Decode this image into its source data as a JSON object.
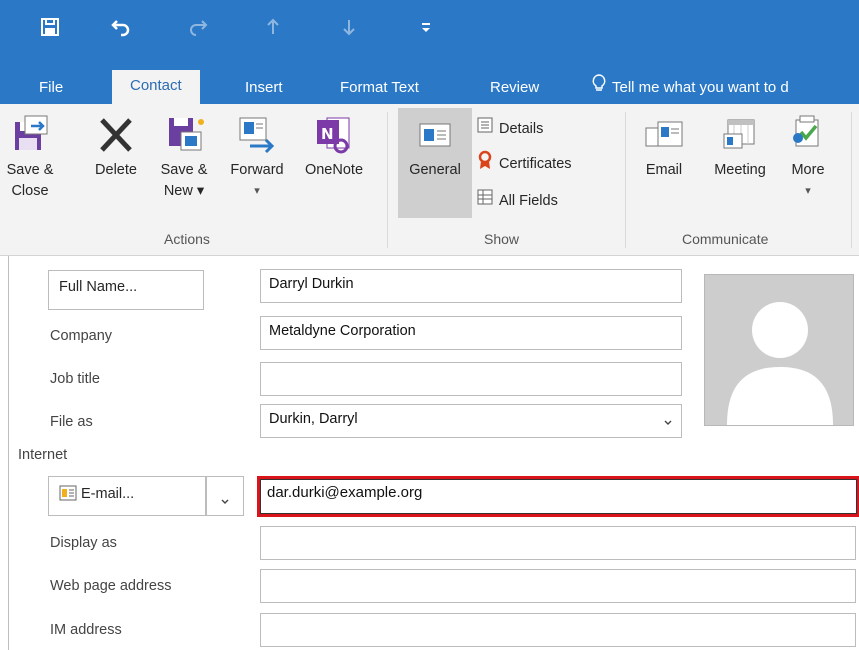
{
  "qat": {
    "icons": [
      "save-icon",
      "undo-icon",
      "redo-icon",
      "previous-item-icon",
      "next-item-icon",
      "customize-qat-icon"
    ]
  },
  "tabs": [
    {
      "label": "File",
      "active": false
    },
    {
      "label": "Contact",
      "active": true
    },
    {
      "label": "Insert",
      "active": false
    },
    {
      "label": "Format Text",
      "active": false
    },
    {
      "label": "Review",
      "active": false
    }
  ],
  "tell_me": "Tell me what you want to d",
  "ribbon": {
    "actions": {
      "group_label": "Actions",
      "save_close": {
        "line1": "Save &",
        "line2": "Close"
      },
      "delete": {
        "line1": "Delete"
      },
      "save_new": {
        "line1": "Save &",
        "line2": "New ▾"
      },
      "forward": {
        "line1": "Forward",
        "line2": "▾"
      },
      "onenote": {
        "line1": "OneNote"
      }
    },
    "show": {
      "group_label": "Show",
      "general": "General",
      "details": "Details",
      "certificates": "Certificates",
      "all_fields": "All Fields"
    },
    "communicate": {
      "group_label": "Communicate",
      "email": "Email",
      "meeting": "Meeting",
      "more": "More",
      "more_arrow": "▾"
    }
  },
  "form": {
    "full_name_button": "Full Name...",
    "full_name_value": "Darryl Durkin",
    "company_label": "Company",
    "company_value": "Metaldyne Corporation",
    "job_title_label": "Job title",
    "job_title_value": "",
    "file_as_label": "File as",
    "file_as_value": "Durkin, Darryl",
    "internet_section": "Internet",
    "email_button": "E-mail...",
    "email_value": "dar.durki@example.org",
    "display_as_label": "Display as",
    "display_as_value": "",
    "web_page_label": "Web page address",
    "web_page_value": "",
    "im_address_label": "IM address",
    "im_address_value": ""
  },
  "colors": {
    "title_bar": "#2b79c6",
    "ribbon_bg": "#f3f3f3",
    "highlight_border": "#d9141b"
  }
}
